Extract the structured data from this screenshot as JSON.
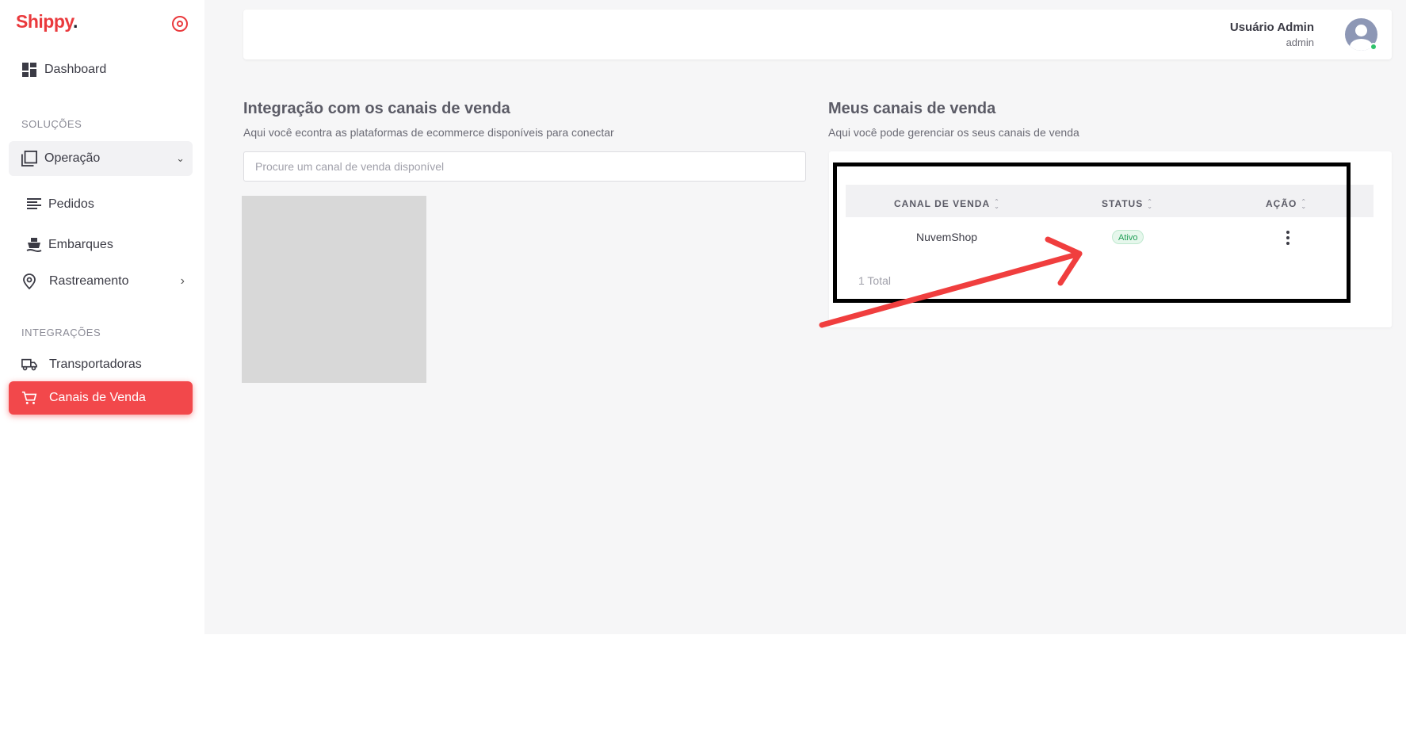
{
  "brand": {
    "name": "Shippy",
    "dot": ".",
    "accent": "#ea3a3d"
  },
  "sidebar": {
    "dashboard": {
      "label": "Dashboard",
      "icon": "dashboard-icon"
    },
    "section_solucoes": "SOLUÇÕES",
    "operacao": {
      "label": "Operação",
      "icon": "layers-icon",
      "expanded": true
    },
    "pedidos": {
      "label": "Pedidos",
      "icon": "list-icon"
    },
    "embarques": {
      "label": "Embarques",
      "icon": "ship-icon"
    },
    "rastreamento": {
      "label": "Rastreamento",
      "icon": "location-pin-icon"
    },
    "section_integracoes": "INTEGRAÇÕES",
    "transportadoras": {
      "label": "Transportadoras",
      "icon": "truck-icon"
    },
    "canais": {
      "label": "Canais de Venda",
      "icon": "cart-icon",
      "active": true
    }
  },
  "header": {
    "user_name": "Usuário Admin",
    "user_role": "admin",
    "status_color": "#2fc26b"
  },
  "integration": {
    "title": "Integração com os canais de venda",
    "subtitle": "Aqui você econtra as plataformas de ecommerce disponíveis para conectar",
    "search_placeholder": "Procure um canal de venda disponível"
  },
  "my_channels": {
    "title": "Meus canais de venda",
    "subtitle": "Aqui você pode gerenciar os seus canais de venda",
    "columns": [
      "CANAL DE VENDA",
      "STATUS",
      "AÇÃO"
    ],
    "rows": [
      {
        "channel": "NuvemShop",
        "status": "Ativo"
      }
    ],
    "total": "1 Total"
  },
  "annotation": {
    "box_color": "#000000",
    "arrow_color": "#f03e3e"
  }
}
